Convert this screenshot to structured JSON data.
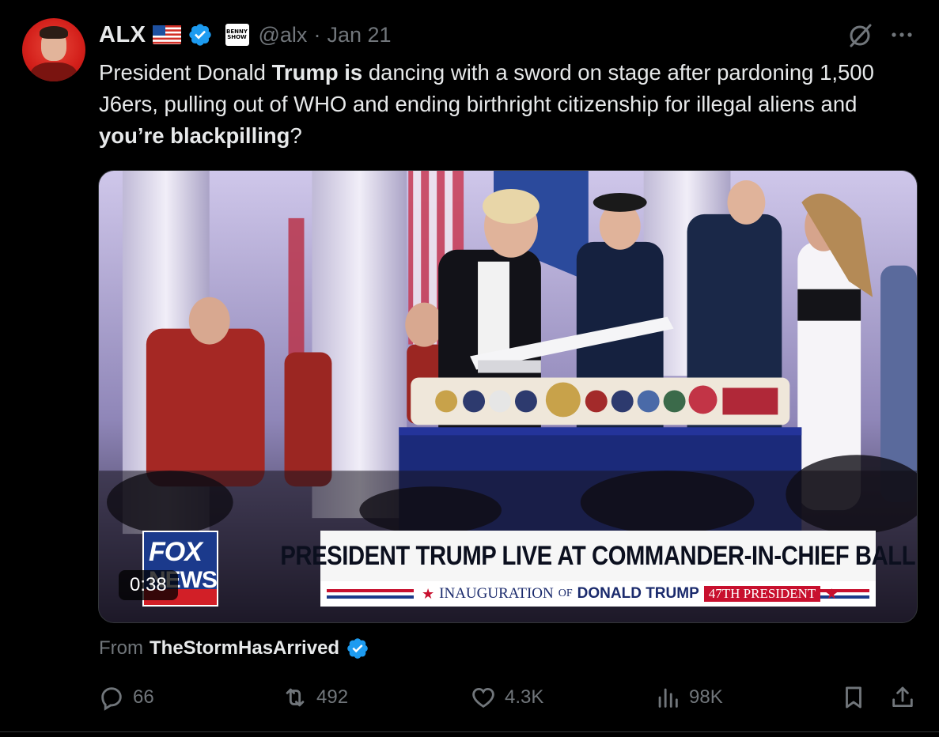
{
  "author": {
    "name": "ALX",
    "handle": "@alx",
    "separator": "·",
    "date": "Jan 21",
    "badge_text": "BENNY SHOW"
  },
  "tweet": {
    "text_parts": [
      "President Donald ",
      "Trump is",
      " dancing with a sword on stage after pardoning 1,500 J6ers, pulling out of WHO and ending birthright citizenship for illegal aliens and ",
      "you’re blackpilling",
      "?"
    ]
  },
  "media": {
    "duration": "0:38",
    "chyron_main": "PRESIDENT TRUMP LIVE AT COMMANDER-IN-CHIEF BALL",
    "chyron_sub_1": "INAUGURATION",
    "chyron_sub_of": "OF",
    "chyron_sub_2": "DONALD TRUMP",
    "chyron_sub_3": "47TH PRESIDENT",
    "logo_fox": "FOX",
    "logo_news": "NEWS"
  },
  "source": {
    "label": "From",
    "name": "TheStormHasArrived"
  },
  "actions": {
    "replies": "66",
    "reposts": "492",
    "likes": "4.3K",
    "views": "98K"
  },
  "colors": {
    "background": "#000000",
    "text": "#e7e9ea",
    "muted": "#71767b",
    "verified": "#1d9bf0"
  }
}
